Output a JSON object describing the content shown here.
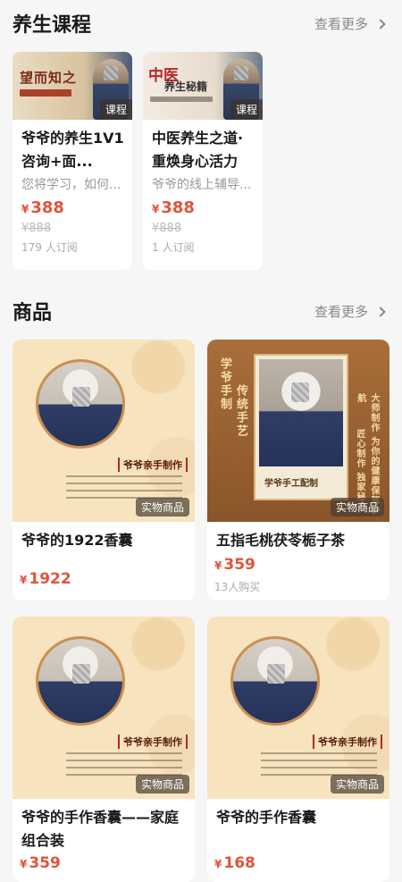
{
  "courses_section": {
    "title": "养生课程",
    "more_label": "查看更多",
    "items": [
      {
        "thumb_title": "望而知之",
        "tag": "课程",
        "title": "爷爷的养生1V1咨询+面...",
        "desc": "您将学习，如何...",
        "price_symbol": "¥",
        "price": "388",
        "original_price": "¥888",
        "subscribers": "179 人订阅"
      },
      {
        "thumb_title": "中医",
        "thumb_title2": "养生秘籍",
        "tag": "课程",
        "title": "中医养生之道·重焕身心活力",
        "desc": "爷爷的线上辅导...",
        "price_symbol": "¥",
        "price": "388",
        "original_price": "¥888",
        "subscribers": "1 人订阅"
      }
    ]
  },
  "goods_section": {
    "title": "商品",
    "more_label": "查看更多",
    "items": [
      {
        "image_label": "爷爷亲手制作",
        "tag": "实物商品",
        "title": "爷爷的1922香囊",
        "price_symbol": "¥",
        "price": "1922",
        "sold": ""
      },
      {
        "image_vertical_1": "学爷手制",
        "image_vertical_2": "传统手艺",
        "image_vertical_3": "大师制作 为你的健康保驾护航",
        "image_vertical_4": "匠心制作 独家秘方",
        "image_caption": "学爷手工配制",
        "tag": "实物商品",
        "title": "五指毛桃茯苓栀子茶",
        "price_symbol": "¥",
        "price": "359",
        "sold": "13人购买"
      },
      {
        "image_label": "爷爷亲手制作",
        "tag": "实物商品",
        "title": "爷爷的手作香囊——家庭组合装",
        "price_symbol": "¥",
        "price": "359",
        "sold": ""
      },
      {
        "image_label": "爷爷亲手制作",
        "tag": "实物商品",
        "title": "爷爷的手作香囊",
        "price_symbol": "¥",
        "price": "168",
        "sold": ""
      }
    ]
  },
  "colors": {
    "price": "#e0543a",
    "muted": "#999999",
    "background": "#f6f6f6"
  },
  "icons": [
    "chevron-right-icon"
  ]
}
